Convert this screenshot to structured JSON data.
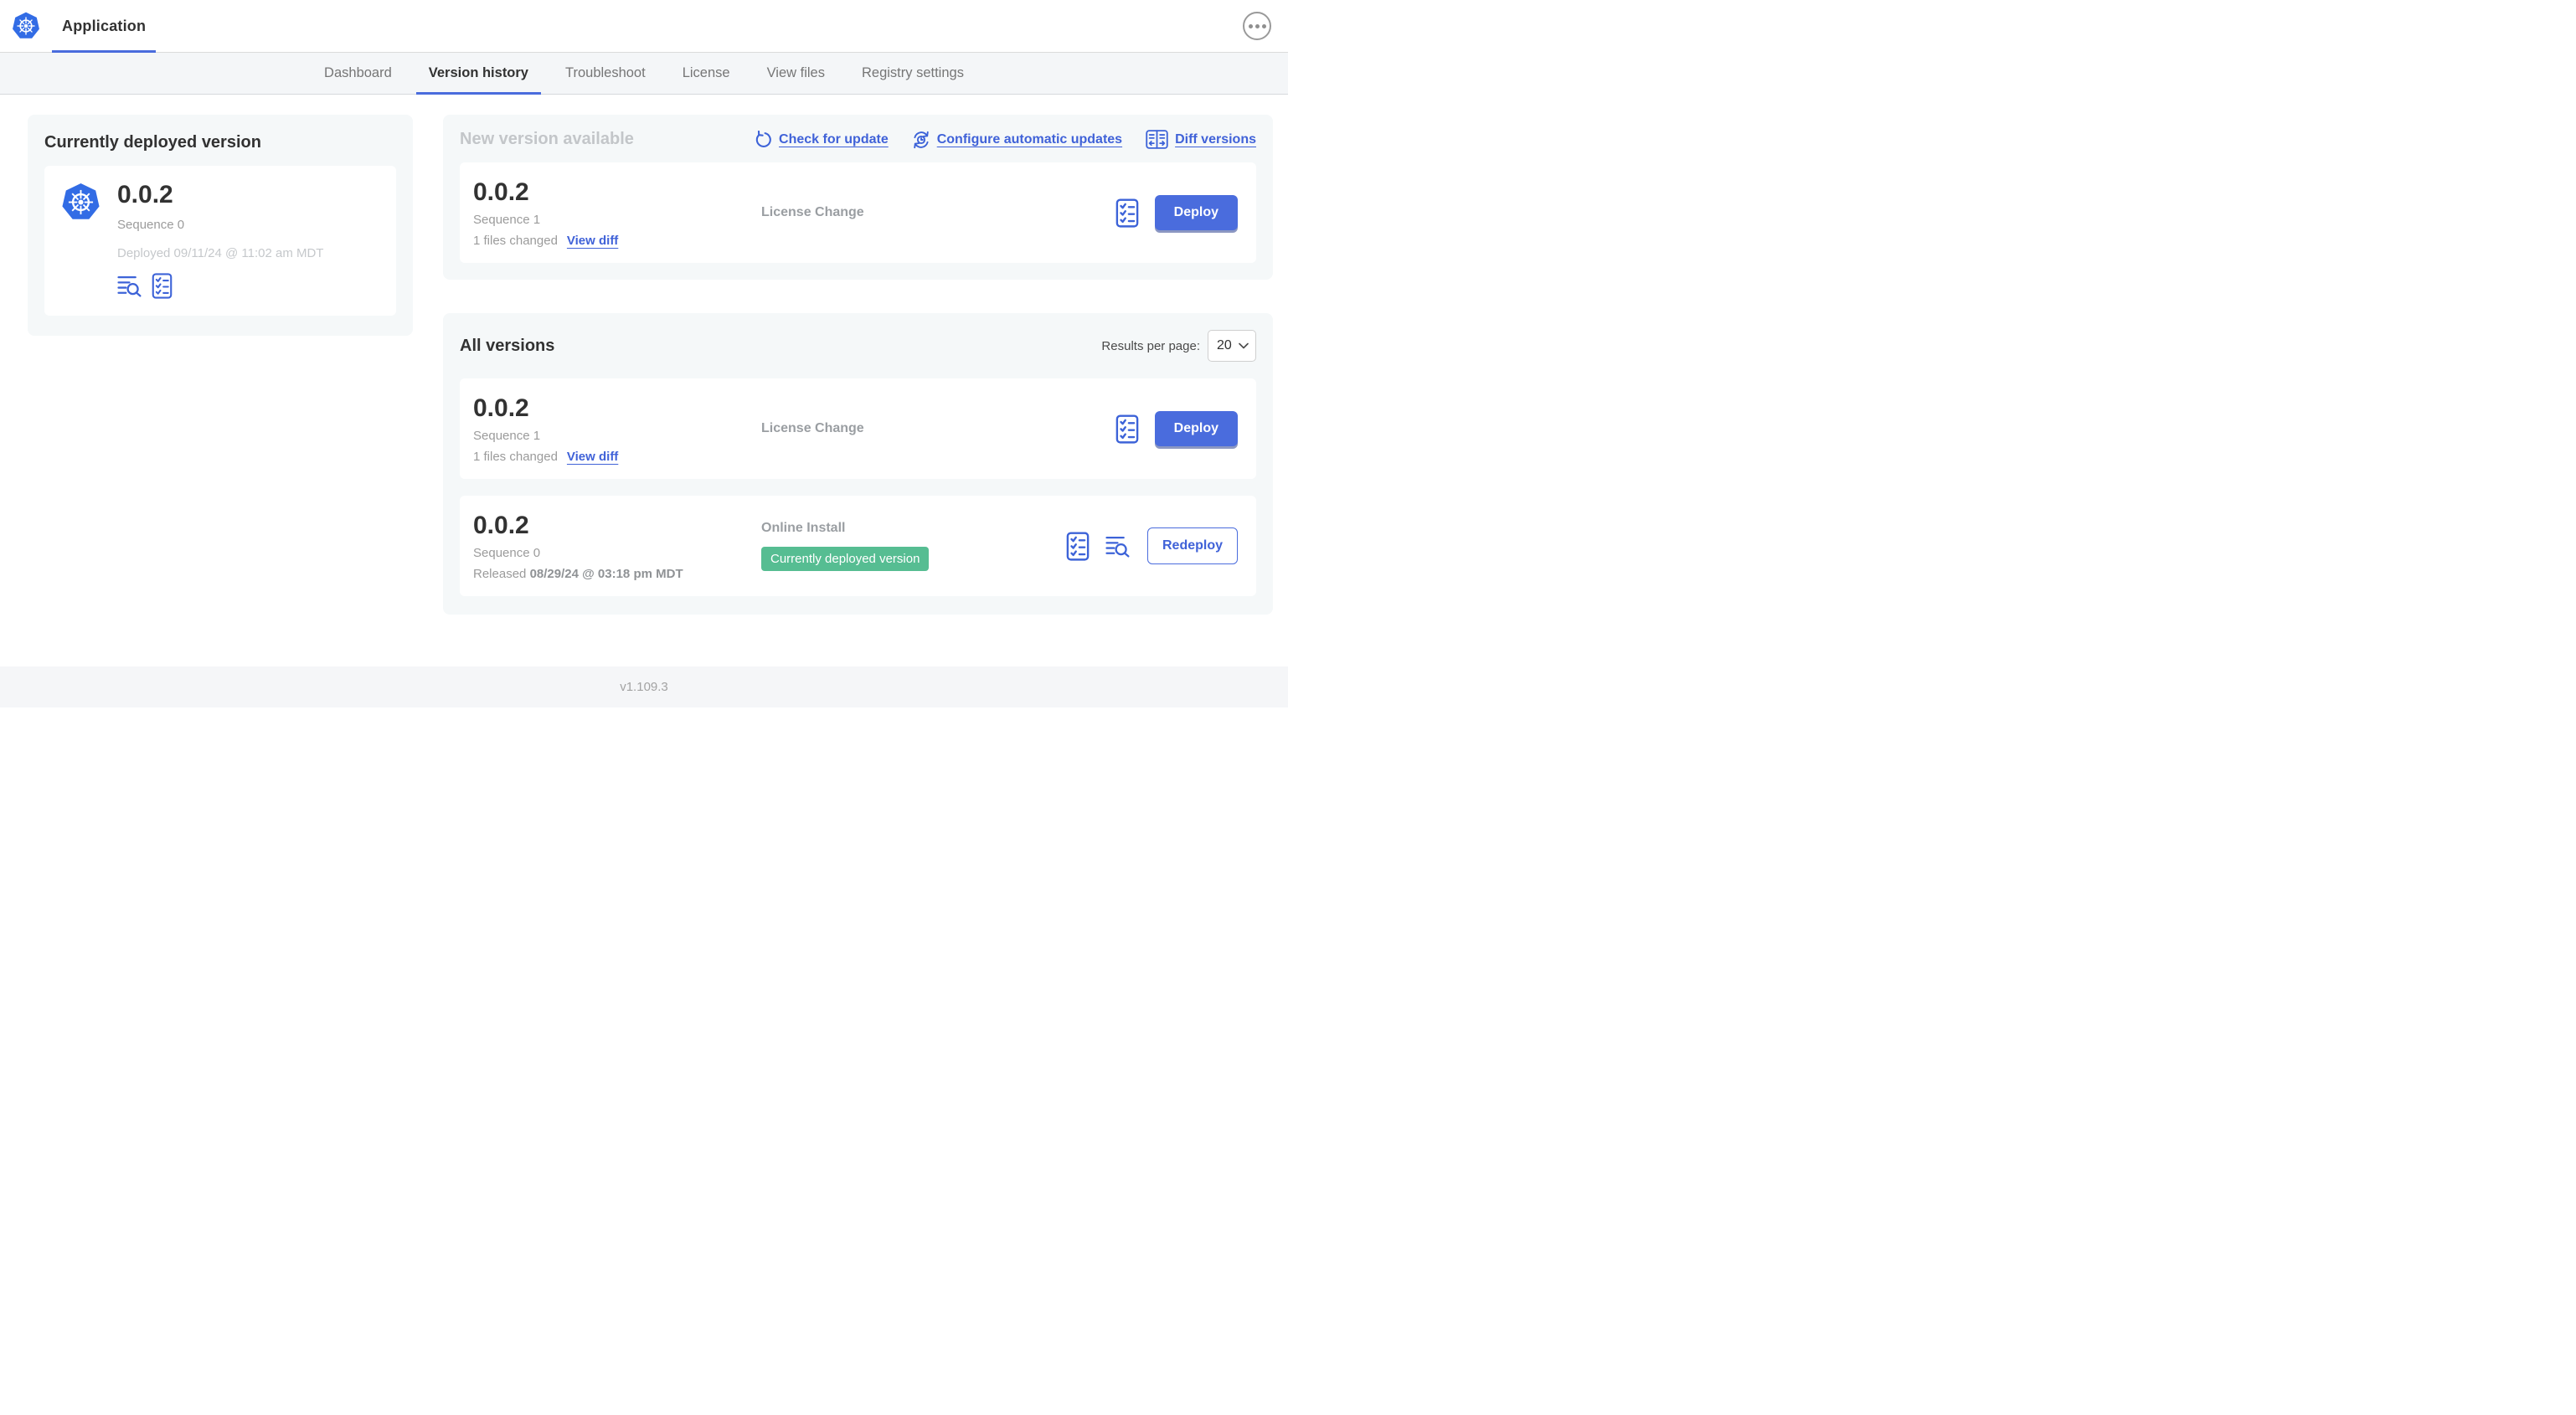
{
  "header": {
    "app_title": "Application",
    "logo_icon": "kubernetes-icon",
    "menu_icon": "ellipsis-icon"
  },
  "nav": {
    "tabs": [
      {
        "label": "Dashboard",
        "active": false
      },
      {
        "label": "Version history",
        "active": true
      },
      {
        "label": "Troubleshoot",
        "active": false
      },
      {
        "label": "License",
        "active": false
      },
      {
        "label": "View files",
        "active": false
      },
      {
        "label": "Registry settings",
        "active": false
      }
    ]
  },
  "current_version_card": {
    "title": "Currently deployed version",
    "version": "0.0.2",
    "sequence": "Sequence 0",
    "deployed": "Deployed 09/11/24 @ 11:02 am MDT",
    "icons": [
      "logs-icon",
      "preflight-checklist-icon"
    ]
  },
  "new_version_card": {
    "title": "New version available",
    "actions": [
      {
        "label": "Check for update",
        "icon": "refresh-icon"
      },
      {
        "label": "Configure automatic updates",
        "icon": "auto-update-clock-icon"
      },
      {
        "label": "Diff versions",
        "icon": "diff-icon"
      }
    ],
    "row": {
      "version": "0.0.2",
      "sequence": "Sequence 1",
      "files_changed": "1 files changed",
      "view_diff_label": "View diff",
      "source": "License Change",
      "icons": [
        "preflight-checklist-icon"
      ],
      "button_label": "Deploy"
    }
  },
  "all_versions_card": {
    "title": "All versions",
    "results_per_page_label": "Results per page:",
    "results_per_page_value": "20",
    "rows": [
      {
        "version": "0.0.2",
        "sequence": "Sequence 1",
        "files_changed": "1 files changed",
        "view_diff_label": "View diff",
        "source": "License Change",
        "icons": [
          "preflight-checklist-icon"
        ],
        "button_label": "Deploy"
      },
      {
        "version": "0.0.2",
        "sequence": "Sequence 0",
        "released_prefix": "Released",
        "released_date": "08/29/24 @ 03:18 pm MDT",
        "source": "Online Install",
        "badge": "Currently deployed version",
        "icons": [
          "preflight-checklist-icon",
          "logs-icon"
        ],
        "button_label": "Redeploy"
      }
    ]
  },
  "footer": {
    "version": "v1.109.3"
  },
  "colors": {
    "accent_blue": "#4a6cdd",
    "kubernetes_blue": "#326ce5",
    "badge_green": "#56bd92",
    "card_bg": "#f5f8f9"
  }
}
